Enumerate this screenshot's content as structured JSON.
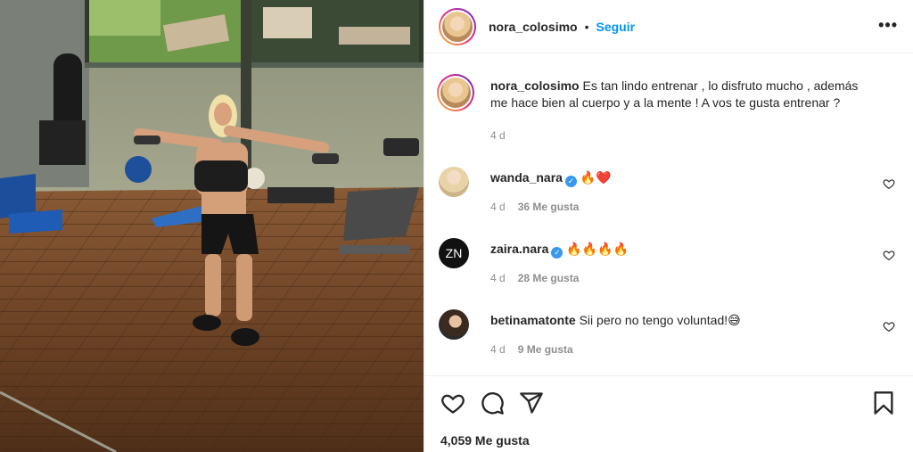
{
  "post": {
    "author": "nora_colosimo",
    "separator": "•",
    "follow_label": "Seguir",
    "more_label": "•••",
    "caption": {
      "user": "nora_colosimo",
      "text": "Es tan lindo entrenar , lo disfruto mucho , además me hace bien al cuerpo y a la mente ! A vos te gusta entrenar ?",
      "time": "4 d"
    },
    "comments": [
      {
        "user": "wanda_nara",
        "verified": true,
        "text": "🔥❤️",
        "time": "4 d",
        "likes": "36 Me gusta"
      },
      {
        "user": "zaira.nara",
        "verified": true,
        "avatar_text": "ZN",
        "text": "🔥🔥🔥🔥",
        "time": "4 d",
        "likes": "28 Me gusta"
      },
      {
        "user": "betinamatonte",
        "verified": false,
        "text": "Sii pero no tengo voluntad!😅",
        "time": "4 d",
        "likes": "9 Me gusta"
      }
    ],
    "likes_total": "4,059 Me gusta",
    "verified_mark": "✓"
  },
  "colors": {
    "accent": "#0095f6",
    "verified": "#3897f0",
    "muted": "#8e8e8e",
    "text": "#262626"
  }
}
